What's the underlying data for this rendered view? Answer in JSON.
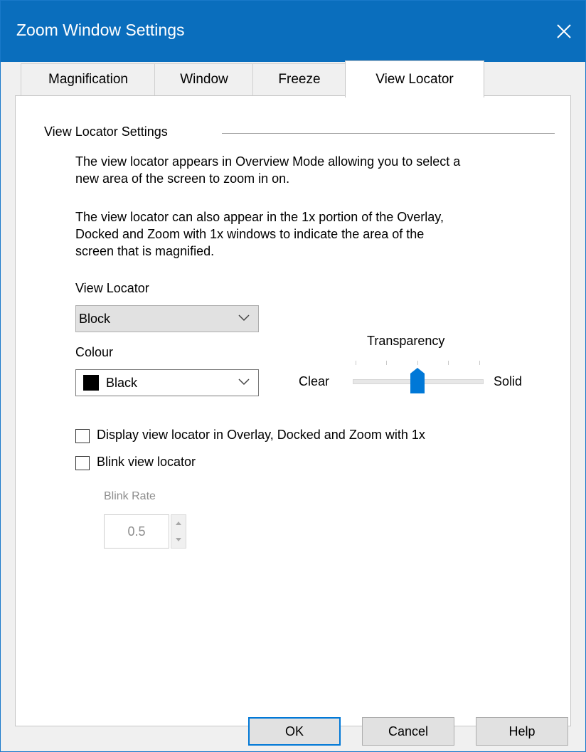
{
  "window": {
    "title": "Zoom Window Settings"
  },
  "tabs": [
    {
      "label": "Magnification",
      "active": false
    },
    {
      "label": "Window",
      "active": false
    },
    {
      "label": "Freeze",
      "active": false
    },
    {
      "label": "View Locator",
      "active": true
    }
  ],
  "group": {
    "title": "View Locator Settings",
    "description_1": [
      "The view locator appears in Overview Mode allowing you to select a",
      "new area of the screen to zoom in on."
    ],
    "description_2": [
      "The view locator can also appear in the 1x portion of the Overlay,",
      "Docked and Zoom with 1x windows to indicate the area of the",
      "screen that is magnified."
    ]
  },
  "view_locator": {
    "label": "View Locator",
    "value": "Block"
  },
  "colour": {
    "label": "Colour",
    "value": "Black",
    "swatch": "#000000"
  },
  "transparency": {
    "label": "Transparency",
    "min_label": "Clear",
    "max_label": "Solid",
    "value_fraction": 0.5,
    "accent": "#0078d7"
  },
  "checkboxes": {
    "display_in_overlay": {
      "label": "Display view locator in Overlay, Docked and Zoom with 1x",
      "checked": false
    },
    "blink": {
      "label": "Blink view locator",
      "checked": false
    }
  },
  "blink_rate": {
    "label": "Blink Rate",
    "value": "0.5",
    "enabled": false
  },
  "buttons": {
    "ok": "OK",
    "cancel": "Cancel",
    "help": "Help"
  }
}
